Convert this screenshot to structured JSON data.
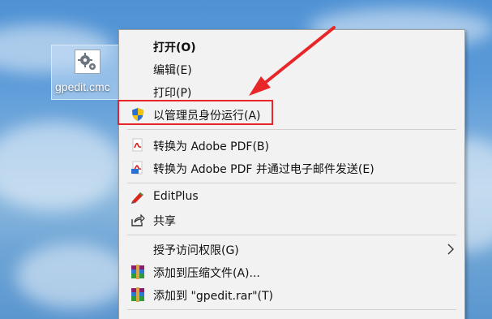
{
  "desktop": {
    "icon": {
      "label": "gpedit.cmc",
      "icon": "settings-file-icon"
    }
  },
  "menu": {
    "items": [
      {
        "label": "打开(O)",
        "bold": true,
        "icon": ""
      },
      {
        "label": "编辑(E)",
        "icon": ""
      },
      {
        "label": "打印(P)",
        "icon": ""
      },
      {
        "label": "以管理员身份运行(A)",
        "icon": "uac-shield-icon"
      },
      {
        "label": "转换为 Adobe PDF(B)",
        "icon": "adobe-pdf-icon"
      },
      {
        "label": "转换为 Adobe PDF 并通过电子邮件发送(E)",
        "icon": "adobe-pdf-email-icon"
      },
      {
        "label": "EditPlus",
        "icon": "editplus-icon"
      },
      {
        "label": "共享",
        "icon": "share-icon"
      },
      {
        "label": "授予访问权限(G)",
        "icon": "",
        "has_submenu": true
      },
      {
        "label": "添加到压缩文件(A)...",
        "icon": "winrar-icon"
      },
      {
        "label": "添加到 \"gpedit.rar\"(T)",
        "icon": "winrar-icon"
      }
    ]
  },
  "annotation": {
    "highlight_color": "#e8262a",
    "arrow_color": "#e8262a"
  }
}
